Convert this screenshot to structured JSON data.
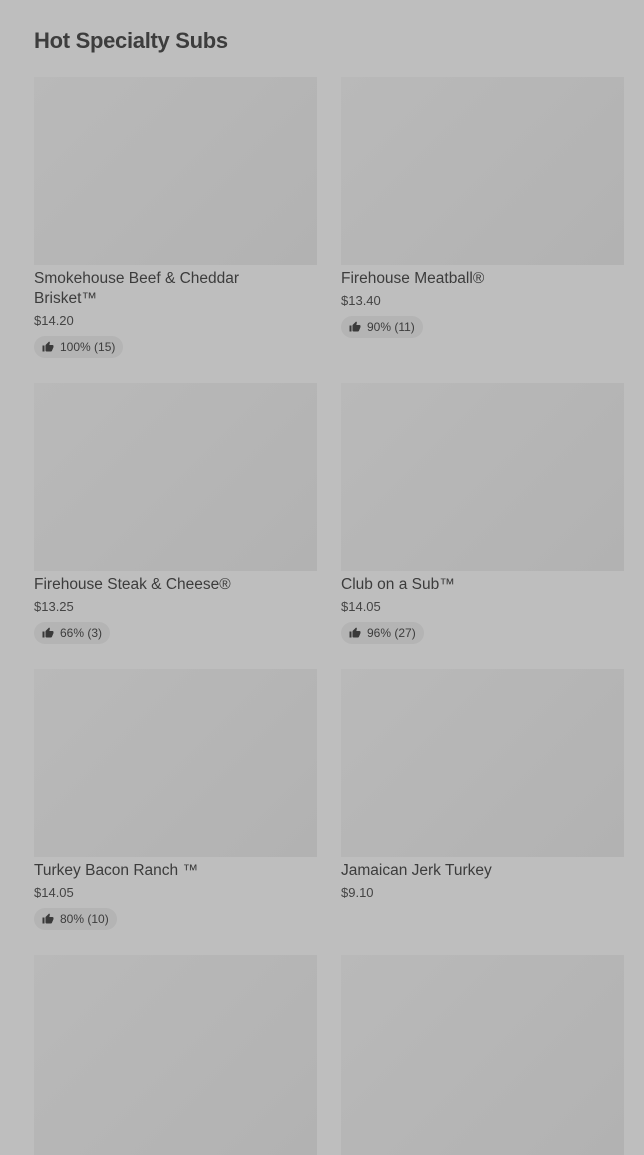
{
  "section": {
    "title": "Hot Specialty Subs"
  },
  "items": [
    {
      "name": "Smokehouse Beef & Cheddar Brisket™",
      "price": "$14.20",
      "rating": "100% (15)"
    },
    {
      "name": "Firehouse Meatball®",
      "price": "$13.40",
      "rating": "90% (11)"
    },
    {
      "name": "Firehouse Steak & Cheese®",
      "price": "$13.25",
      "rating": "66% (3)"
    },
    {
      "name": "Club on a Sub™",
      "price": "$14.05",
      "rating": "96% (27)"
    },
    {
      "name": "Turkey Bacon Ranch ™",
      "price": "$14.05",
      "rating": "80% (10)"
    },
    {
      "name": "Jamaican Jerk Turkey",
      "price": "$9.10"
    }
  ],
  "icons": {
    "rating": "thumbs-up-icon"
  }
}
